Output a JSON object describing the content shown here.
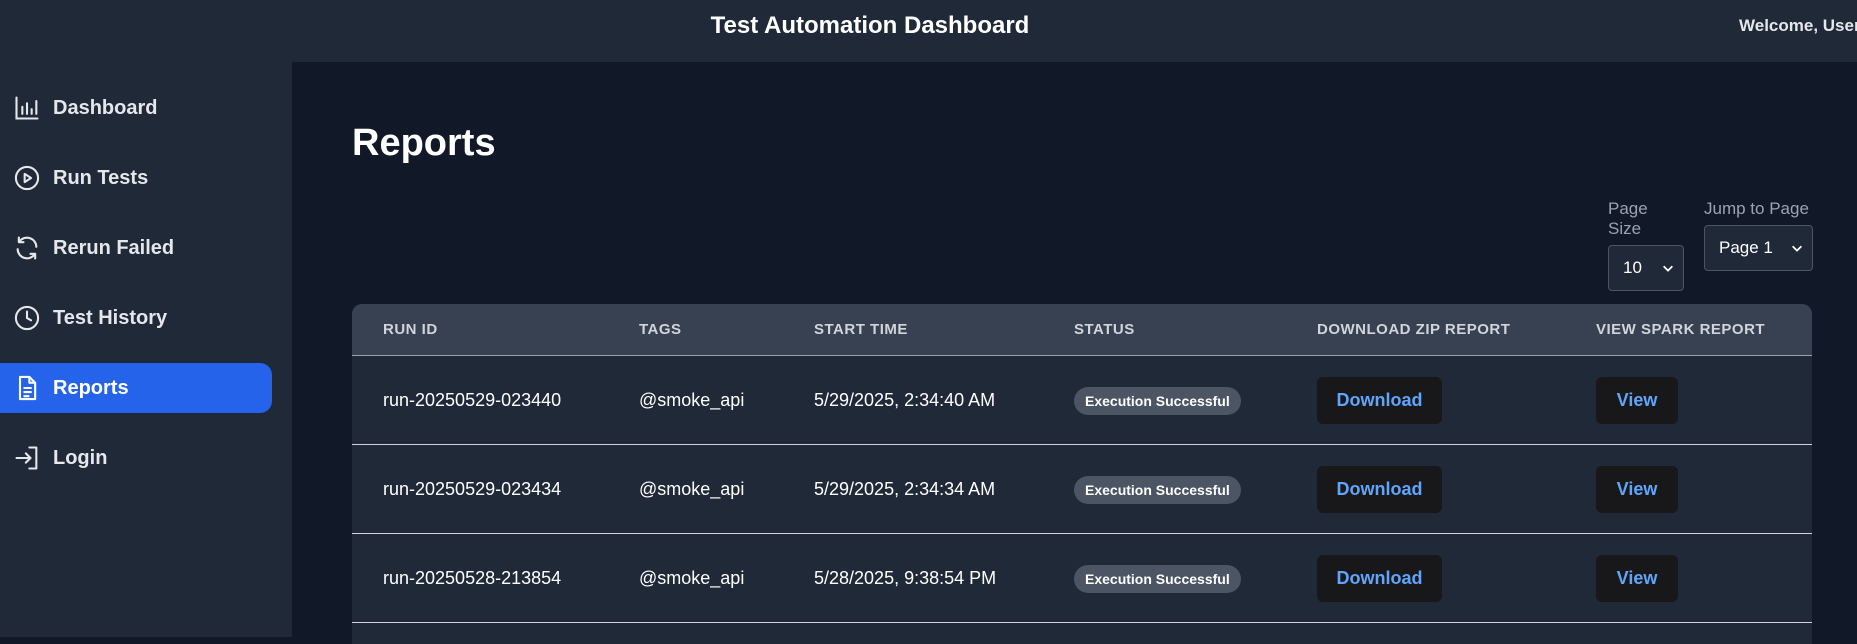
{
  "header": {
    "title": "Test Automation Dashboard",
    "welcome": "Welcome, User"
  },
  "sidebar": {
    "items": [
      {
        "label": "Dashboard",
        "icon": "bar-chart-icon"
      },
      {
        "label": "Run Tests",
        "icon": "play-circle-icon"
      },
      {
        "label": "Rerun Failed",
        "icon": "refresh-icon"
      },
      {
        "label": "Test History",
        "icon": "clock-icon"
      },
      {
        "label": "Reports",
        "icon": "document-icon",
        "active": true
      },
      {
        "label": "Login",
        "icon": "login-icon"
      }
    ]
  },
  "main": {
    "title": "Reports",
    "page_size": {
      "label": "Page Size",
      "value": "10"
    },
    "jump_to_page": {
      "label": "Jump to Page",
      "value": "Page 1"
    },
    "table": {
      "columns": [
        "RUN ID",
        "TAGS",
        "START TIME",
        "STATUS",
        "DOWNLOAD ZIP REPORT",
        "VIEW SPARK REPORT"
      ],
      "rows": [
        {
          "run_id": "run-20250529-023440",
          "tags": "@smoke_api",
          "start_time": "5/29/2025, 2:34:40 AM",
          "status": "Execution Successful",
          "download": "Download",
          "view": "View"
        },
        {
          "run_id": "run-20250529-023434",
          "tags": "@smoke_api",
          "start_time": "5/29/2025, 2:34:34 AM",
          "status": "Execution Successful",
          "download": "Download",
          "view": "View"
        },
        {
          "run_id": "run-20250528-213854",
          "tags": "@smoke_api",
          "start_time": "5/28/2025, 9:38:54 PM",
          "status": "Execution Successful",
          "download": "Download",
          "view": "View"
        }
      ]
    }
  },
  "colors": {
    "background": "#111827",
    "panel": "#1f2937",
    "accent": "#2563eb",
    "link": "#60a5fa",
    "badge": "#4b5563"
  }
}
